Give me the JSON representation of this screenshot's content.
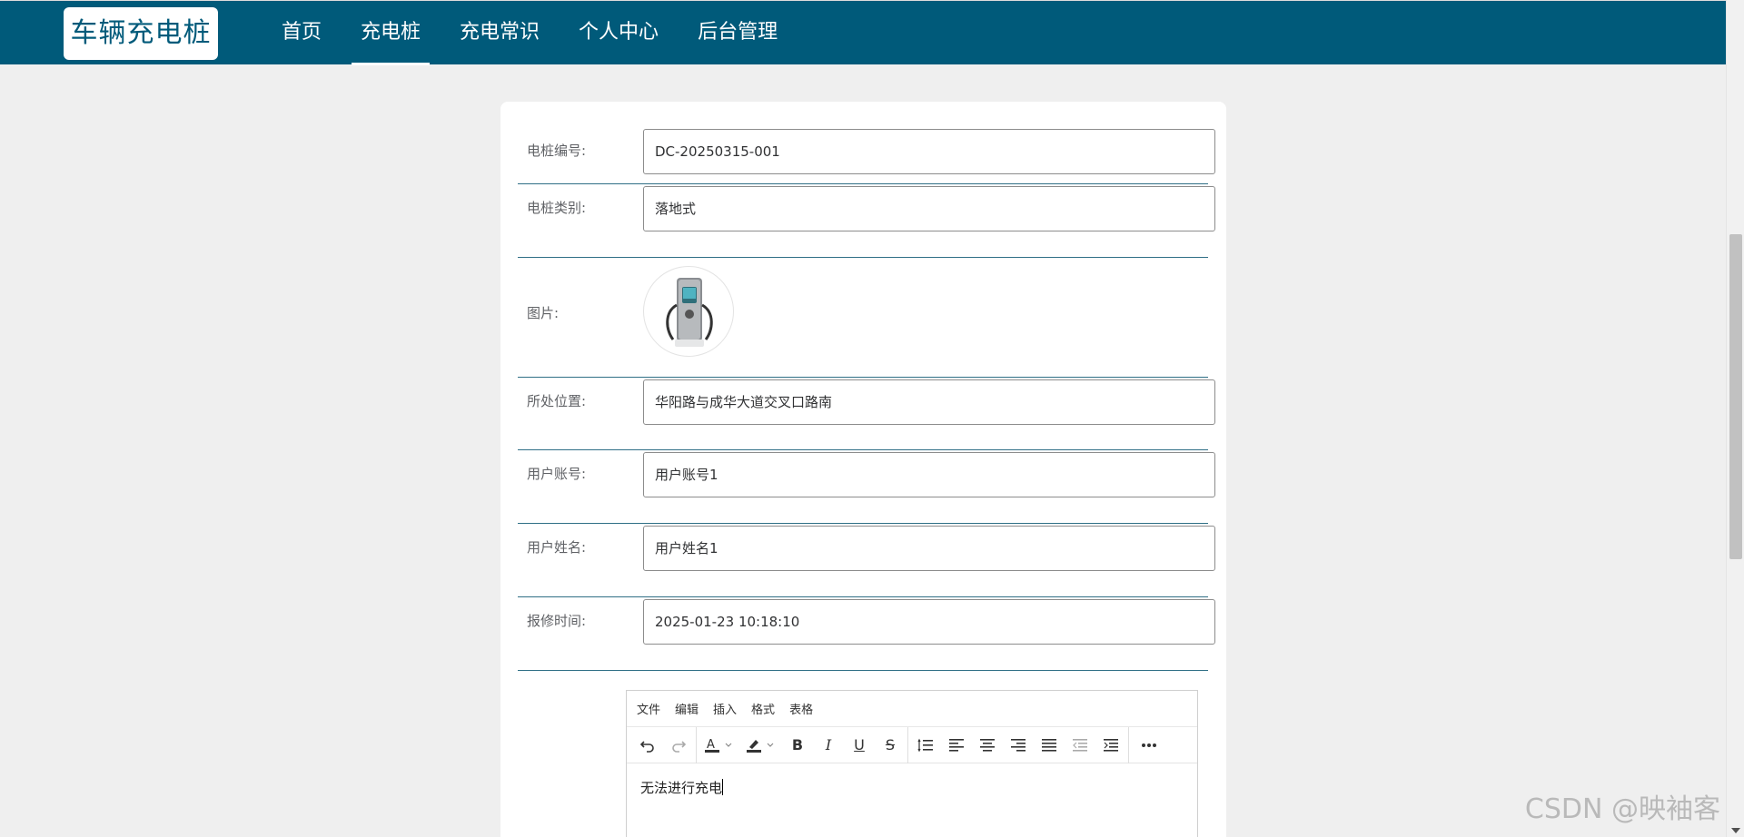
{
  "app": {
    "brand": "车辆充电桩",
    "nav": [
      {
        "label": "首页",
        "active": false
      },
      {
        "label": "充电桩",
        "active": true
      },
      {
        "label": "充电常识",
        "active": false
      },
      {
        "label": "个人中心",
        "active": false
      },
      {
        "label": "后台管理",
        "active": false
      }
    ]
  },
  "form": {
    "pile_no": {
      "label": "电桩编号:",
      "value": "DC-20250315-001"
    },
    "pile_type": {
      "label": "电桩类别:",
      "value": "落地式"
    },
    "image": {
      "label": "图片:"
    },
    "location": {
      "label": "所处位置:",
      "value": "华阳路与成华大道交叉口路南"
    },
    "account": {
      "label": "用户账号:",
      "value": "用户账号1"
    },
    "username": {
      "label": "用户姓名:",
      "value": "用户姓名1"
    },
    "repair_time": {
      "label": "报修时间:",
      "value": "2025-01-23 10:18:10"
    }
  },
  "editor": {
    "menu": [
      "文件",
      "编辑",
      "插入",
      "格式",
      "表格"
    ],
    "content": "无法进行充电"
  },
  "watermark": "CSDN @映袖客",
  "colors": {
    "brand": "#005a7a",
    "divider": "#2f6f86"
  }
}
